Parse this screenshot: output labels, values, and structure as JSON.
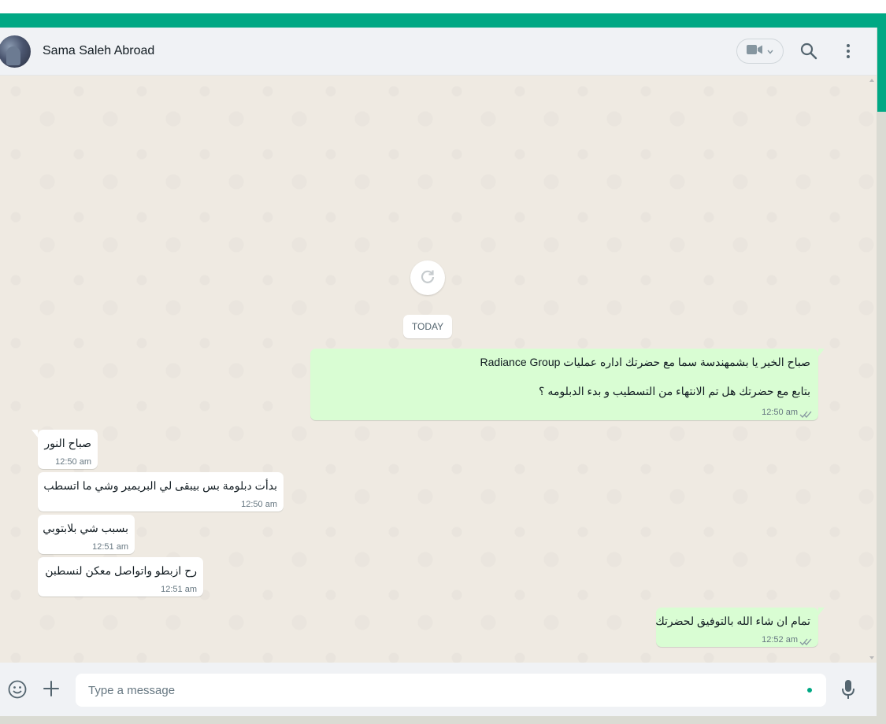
{
  "colors": {
    "accent": "#00a884",
    "outgoing_bubble": "#d9fdd3",
    "incoming_bubble": "#ffffff",
    "chat_background": "#efeae2",
    "header_background": "#f0f2f5"
  },
  "header": {
    "contact_name": "Sama Saleh Abroad",
    "icons": [
      "video-call-icon",
      "chevron-down-icon",
      "search-icon",
      "more-options-icon"
    ]
  },
  "chat": {
    "date_divider": "TODAY",
    "messages": [
      {
        "direction": "out",
        "lines": [
          "صباح الخير يا بشمهندسة سما مع  حضرتك اداره عمليات Radiance Group",
          "بتابع مع حضرتك هل تم الانتهاء من التسطيب و بدء الدبلومه ؟"
        ],
        "time": "12:50 am",
        "status": "read"
      },
      {
        "direction": "in",
        "text": "صباح النور",
        "time": "12:50 am"
      },
      {
        "direction": "in",
        "text": "بدأت دبلومة بس بيبقى لي البريمير وشي ما اتسطب",
        "time": "12:50 am"
      },
      {
        "direction": "in",
        "text": "بسبب شي بلابتوبي",
        "time": "12:51 am"
      },
      {
        "direction": "in",
        "text": "رح ازبطو واتواصل معكن لنسطبن",
        "time": "12:51 am"
      },
      {
        "direction": "out",
        "text": "تمام ان شاء الله بالتوفيق لحضرتك",
        "time": "12:52 am",
        "status": "read"
      }
    ]
  },
  "composer": {
    "placeholder": "Type a message",
    "icons": [
      "emoji-icon",
      "attach-plus-icon",
      "microphone-icon"
    ]
  }
}
